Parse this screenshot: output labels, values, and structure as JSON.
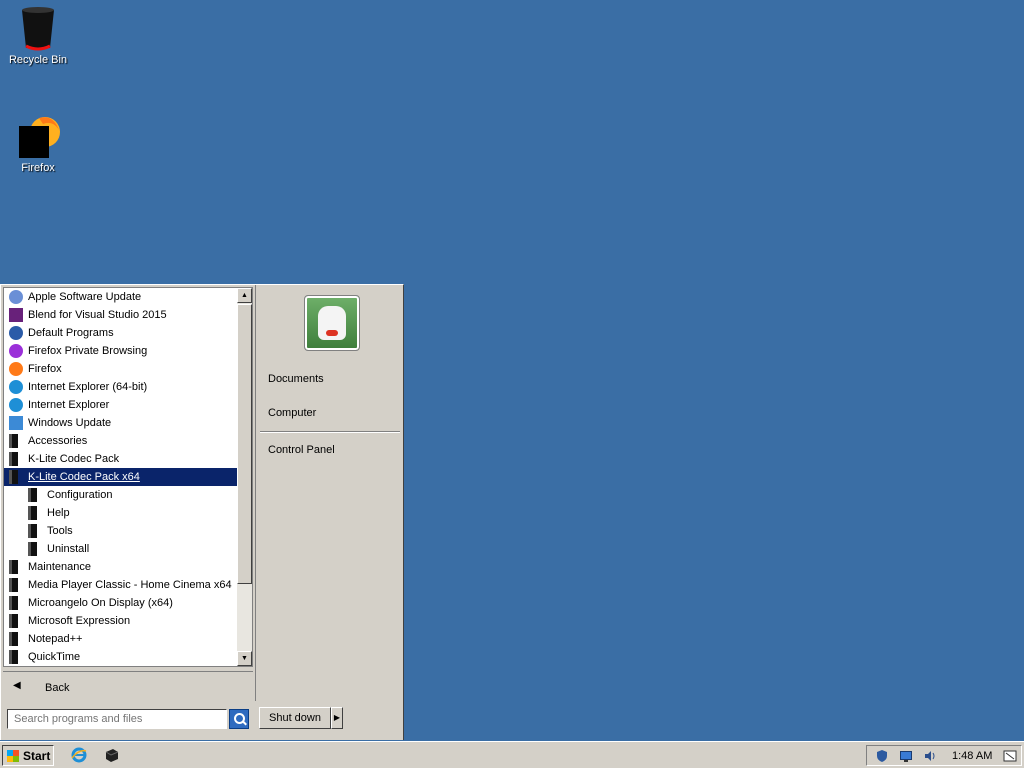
{
  "desktop": {
    "icons": [
      {
        "label": "Recycle Bin"
      },
      {
        "label": "Firefox"
      }
    ]
  },
  "start_menu": {
    "programs": [
      {
        "label": "Apple Software Update",
        "icon": "apple-update-icon"
      },
      {
        "label": "Blend for Visual Studio 2015",
        "icon": "blend-icon"
      },
      {
        "label": "Default Programs",
        "icon": "default-programs-icon"
      },
      {
        "label": "Firefox Private Browsing",
        "icon": "firefox-private-icon"
      },
      {
        "label": "Firefox",
        "icon": "firefox-icon"
      },
      {
        "label": "Internet Explorer (64-bit)",
        "icon": "ie-icon"
      },
      {
        "label": "Internet Explorer",
        "icon": "ie-icon"
      },
      {
        "label": "Windows Update",
        "icon": "windows-update-icon"
      },
      {
        "label": "Accessories",
        "icon": "folder-icon"
      },
      {
        "label": "K-Lite Codec Pack",
        "icon": "folder-icon"
      },
      {
        "label": "K-Lite Codec Pack x64",
        "icon": "folder-icon",
        "selected": true
      },
      {
        "label": "Configuration",
        "icon": "folder-icon",
        "sub": true
      },
      {
        "label": "Help",
        "icon": "folder-icon",
        "sub": true
      },
      {
        "label": "Tools",
        "icon": "folder-icon",
        "sub": true
      },
      {
        "label": "Uninstall",
        "icon": "folder-icon",
        "sub": true
      },
      {
        "label": "Maintenance",
        "icon": "folder-icon"
      },
      {
        "label": "Media Player Classic - Home Cinema x64",
        "icon": "folder-icon"
      },
      {
        "label": "Microangelo On Display (x64)",
        "icon": "folder-icon"
      },
      {
        "label": "Microsoft Expression",
        "icon": "folder-icon"
      },
      {
        "label": "Notepad++",
        "icon": "folder-icon"
      },
      {
        "label": "QuickTime",
        "icon": "folder-icon"
      }
    ],
    "back_label": "Back",
    "search_placeholder": "Search programs and files",
    "right_links": {
      "documents": "Documents",
      "computer": "Computer",
      "control_panel": "Control Panel"
    },
    "shutdown_label": "Shut down"
  },
  "taskbar": {
    "start_label": "Start",
    "clock": "1:48 AM"
  },
  "colors": {
    "desktop": "#3a6ea5",
    "selection": "#0a246a",
    "chrome": "#d4d0c8"
  }
}
